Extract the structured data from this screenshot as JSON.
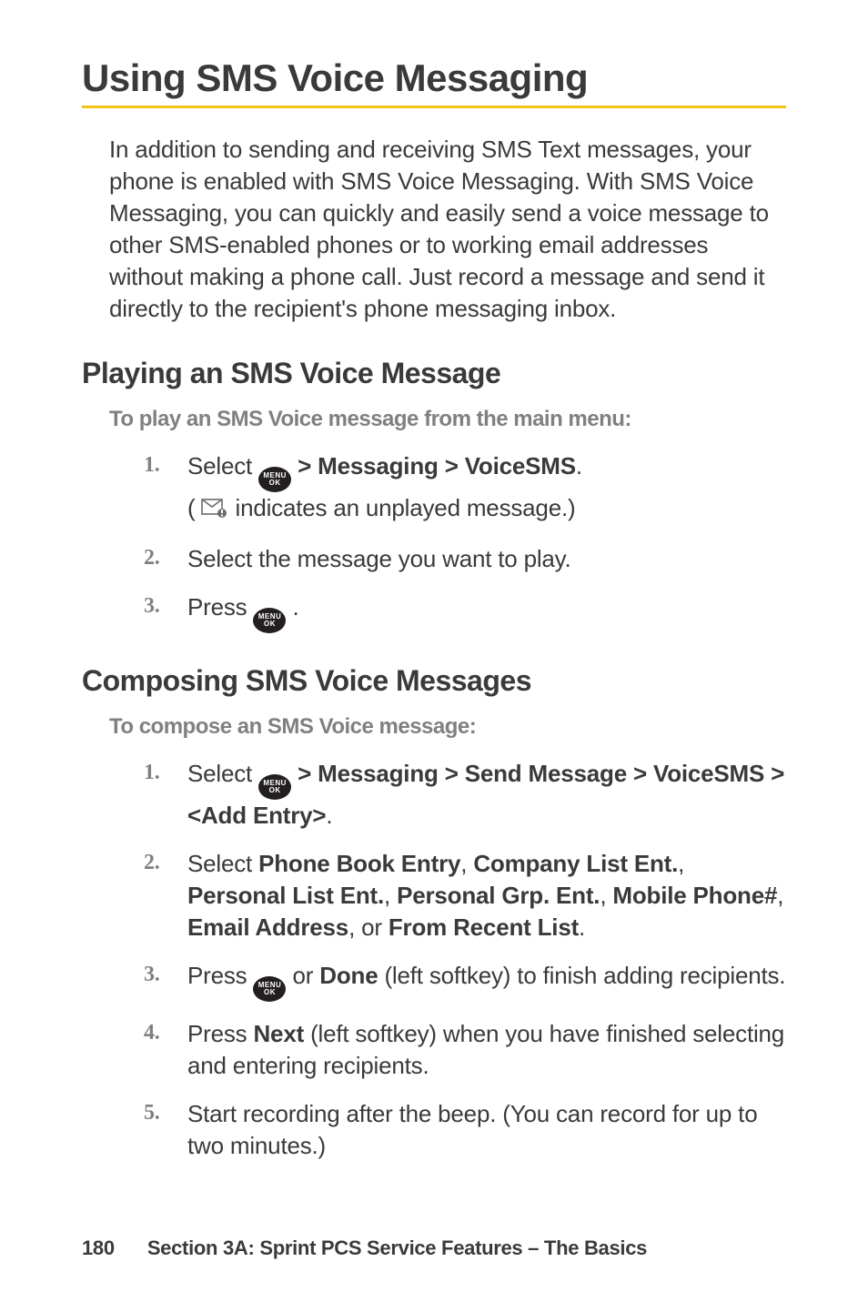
{
  "title": "Using SMS Voice Messaging",
  "intro": "In addition to sending and receiving SMS Text messages, your phone is enabled with SMS Voice Messaging. With SMS Voice Messaging, you can quickly and easily send a voice message to other SMS-enabled phones or to working email addresses without making a phone call. Just record a message and send it directly to the recipient's phone messaging inbox.",
  "section1": {
    "heading": "Playing an SMS Voice Message",
    "lead": "To play an SMS Voice message from the main menu:",
    "steps": {
      "s1_a": "Select ",
      "s1_b": " > Messaging > VoiceSMS",
      "s1_c": ".",
      "s1_d": "( ",
      "s1_e": " indicates an unplayed message.)",
      "s2": "Select the message you want to play.",
      "s3_a": "Press ",
      "s3_b": " ."
    }
  },
  "section2": {
    "heading": "Composing SMS Voice Messages",
    "lead": "To compose an SMS Voice message:",
    "steps": {
      "s1_a": "Select ",
      "s1_b": " > Messaging > Send Message > VoiceSMS > <Add Entry>",
      "s1_c": ".",
      "s2_a": "Select ",
      "s2_b": "Phone Book Entry",
      "s2_c": ",  ",
      "s2_d": "Company List  Ent.",
      "s2_e": ", ",
      "s2_f": "Personal List Ent.",
      "s2_g": ",  ",
      "s2_h": "Personal Grp. Ent.",
      "s2_i": ",  ",
      "s2_j": "Mobile Phone#",
      "s2_k": ", ",
      "s2_l": "Email Address",
      "s2_m": ", or  ",
      "s2_n": "From Recent List",
      "s2_o": ".",
      "s3_a": "Press ",
      "s3_b": " or ",
      "s3_c": "Done",
      "s3_d": " (left softkey) to finish adding recipients.",
      "s4_a": "Press ",
      "s4_b": "Next",
      "s4_c": " (left softkey) when you have finished selecting and entering recipients.",
      "s5": "Start recording after the beep. (You can record for up to two minutes.)"
    }
  },
  "footer": {
    "page": "180",
    "label": "Section 3A: Sprint PCS Service Features – The Basics"
  },
  "icons": {
    "menu_top": "MENU",
    "menu_bot": "OK"
  }
}
